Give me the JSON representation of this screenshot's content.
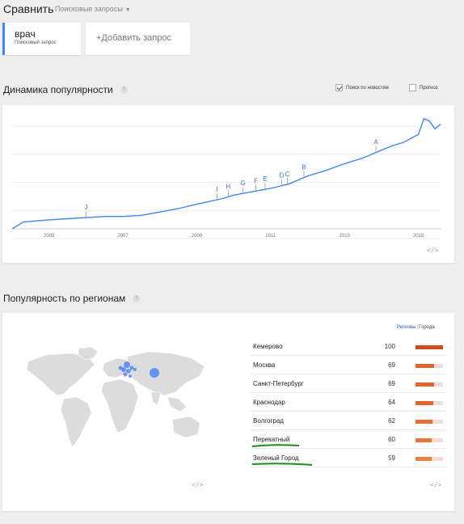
{
  "header": {
    "title": "Сравнить",
    "dropdown_label": "Поисковые запросы"
  },
  "terms": [
    {
      "name": "врач",
      "type": "Поисковый запрос"
    }
  ],
  "add_query_label": "+Добавить запрос",
  "trend": {
    "title": "Динамика популярности",
    "help_label": "?",
    "option_news": "Поиск по новостям",
    "option_forecast": "Прогноз",
    "news_checked": true,
    "forecast_checked": false,
    "embed_label": "</>",
    "line_color": "#4285f4"
  },
  "chart_data": {
    "type": "line",
    "x_tick_labels": [
      "2005",
      "2007",
      "2009",
      "2011",
      "2013",
      "2015"
    ],
    "xlim": [
      2004,
      2015.6
    ],
    "ylim": [
      0,
      100
    ],
    "grid": true,
    "series": [
      {
        "x": [
          2004.0,
          2004.3,
          2004.6,
          2005.0,
          2005.5,
          2006.0,
          2006.5,
          2007.0,
          2007.5,
          2008.0,
          2008.5,
          2009.0,
          2009.3,
          2009.7,
          2010.0,
          2010.5,
          2011.0,
          2011.5,
          2012.0,
          2012.5,
          2013.0,
          2013.5,
          2014.0,
          2014.3,
          2014.6,
          2015.0,
          2015.15,
          2015.3,
          2015.45,
          2015.6
        ],
        "y": [
          0,
          6,
          7,
          8,
          9,
          10,
          11,
          11,
          12,
          15,
          18,
          22,
          24,
          27,
          30,
          33,
          36,
          40,
          47,
          52,
          58,
          63,
          70,
          74,
          77,
          84,
          98,
          96,
          89,
          93
        ]
      }
    ],
    "annotations": [
      {
        "label": "J",
        "x": 2006.0
      },
      {
        "label": "I",
        "x": 2009.55
      },
      {
        "label": "H",
        "x": 2009.85
      },
      {
        "label": "G",
        "x": 2010.25
      },
      {
        "label": "F",
        "x": 2010.6
      },
      {
        "label": "E",
        "x": 2010.85
      },
      {
        "label": "D",
        "x": 2011.3
      },
      {
        "label": "C",
        "x": 2011.45
      },
      {
        "label": "B",
        "x": 2011.9
      },
      {
        "label": "A",
        "x": 2013.85
      }
    ]
  },
  "regions": {
    "title": "Популярность по регионам",
    "help_label": "?",
    "tab_regions": "Регионы",
    "tab_separator": "|",
    "tab_cities": "Города",
    "embed_label": "</>",
    "map_embed_label": "</>",
    "rows": [
      {
        "name": "Кемерово",
        "value": 100,
        "color": "#d04a1c"
      },
      {
        "name": "Москва",
        "value": 69,
        "color": "#e0662a"
      },
      {
        "name": "Санкт-Петербург",
        "value": 69,
        "color": "#e0662a"
      },
      {
        "name": "Краснодар",
        "value": 64,
        "color": "#e0662a"
      },
      {
        "name": "Волгоград",
        "value": 62,
        "color": "#e46f32"
      },
      {
        "name": "Перекатный",
        "value": 60,
        "color": "#e67737"
      },
      {
        "name": "Зеленый Город",
        "value": 59,
        "color": "#e9803f"
      }
    ],
    "underline_color": "#1a8f1a",
    "bubble_color": "#4285f4"
  }
}
